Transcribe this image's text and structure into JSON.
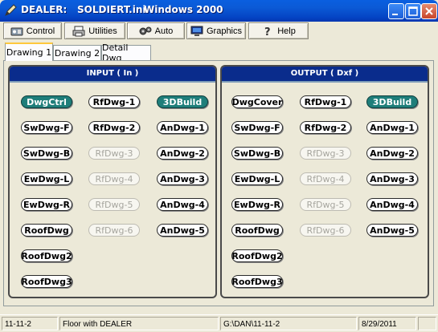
{
  "window": {
    "app_name": "DEALER:",
    "file_name": "SOLDIERT.ini",
    "os_label": "Windows 2000"
  },
  "toolbar": {
    "control": "Control",
    "utilities": "Utilities",
    "auto": "Auto",
    "graphics": "Graphics",
    "help": "Help"
  },
  "tabs": [
    "Drawing 1",
    "Drawing 2",
    "Detail Dwg"
  ],
  "input_panel": {
    "title": "INPUT ( In )",
    "col1": [
      "DwgCtrl",
      "SwDwg-F",
      "SwDwg-B",
      "EwDwg-L",
      "EwDwg-R",
      "RoofDwg",
      "RoofDwg2",
      "RoofDwg3"
    ],
    "col2": [
      "RfDwg-1",
      "RfDwg-2",
      "RfDwg-3",
      "RfDwg-4",
      "RfDwg-5",
      "RfDwg-6"
    ],
    "col3": [
      "3DBuild",
      "AnDwg-1",
      "AnDwg-2",
      "AnDwg-3",
      "AnDwg-4",
      "AnDwg-5"
    ]
  },
  "output_panel": {
    "title": "OUTPUT ( Dxf )",
    "col1": [
      "DwgCover",
      "SwDwg-F",
      "SwDwg-B",
      "EwDwg-L",
      "EwDwg-R",
      "RoofDwg",
      "RoofDwg2",
      "RoofDwg3"
    ],
    "col2": [
      "RfDwg-1",
      "RfDwg-2",
      "RfDwg-3",
      "RfDwg-4",
      "RfDwg-5",
      "RfDwg-6"
    ],
    "col3": [
      "3DBuild",
      "AnDwg-1",
      "AnDwg-2",
      "AnDwg-3",
      "AnDwg-4",
      "AnDwg-5"
    ]
  },
  "statusbar": {
    "job": "11-11-2",
    "description": "Floor with DEALER",
    "path": "G:\\DAN\\11-11-2",
    "date": "8/29/2011"
  },
  "colors": {
    "title_blue": "#0444C4",
    "panel_header": "#0A2C8C",
    "active_pill": "#1F7E7A",
    "face": "#ECE9D8"
  }
}
